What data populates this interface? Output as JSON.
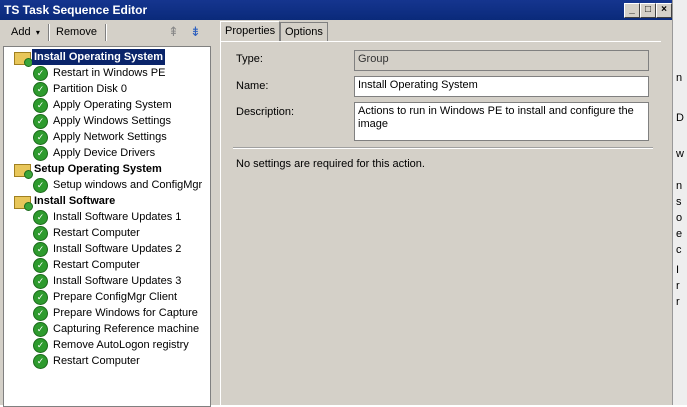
{
  "window": {
    "title": "TS Task Sequence Editor"
  },
  "toolbar": {
    "add_label": "Add",
    "remove_label": "Remove"
  },
  "tree": [
    {
      "label": "Install Operating System",
      "type": "group",
      "level": 0,
      "selected": true
    },
    {
      "label": "Restart in Windows PE",
      "type": "step",
      "level": 1
    },
    {
      "label": "Partition Disk 0",
      "type": "step",
      "level": 1
    },
    {
      "label": "Apply Operating System",
      "type": "step",
      "level": 1
    },
    {
      "label": "Apply Windows Settings",
      "type": "step",
      "level": 1
    },
    {
      "label": "Apply Network Settings",
      "type": "step",
      "level": 1
    },
    {
      "label": "Apply Device Drivers",
      "type": "step",
      "level": 1
    },
    {
      "label": "Setup Operating System",
      "type": "group",
      "level": 0
    },
    {
      "label": "Setup windows and ConfigMgr",
      "type": "step",
      "level": 1
    },
    {
      "label": "Install Software",
      "type": "group",
      "level": 0
    },
    {
      "label": "Install Software Updates 1",
      "type": "step",
      "level": 1
    },
    {
      "label": "Restart Computer",
      "type": "step",
      "level": 1
    },
    {
      "label": "Install Software Updates 2",
      "type": "step",
      "level": 1
    },
    {
      "label": "Restart Computer",
      "type": "step",
      "level": 1
    },
    {
      "label": "Install Software Updates 3",
      "type": "step",
      "level": 1
    },
    {
      "label": "Prepare ConfigMgr Client",
      "type": "step",
      "level": 1
    },
    {
      "label": "Prepare Windows for Capture",
      "type": "step",
      "level": 1
    },
    {
      "label": "Capturing Reference machine",
      "type": "step",
      "level": 1
    },
    {
      "label": "Remove AutoLogon registry",
      "type": "step",
      "level": 1
    },
    {
      "label": "Restart Computer",
      "type": "step",
      "level": 1
    }
  ],
  "tabs": [
    {
      "label": "Properties",
      "active": true
    },
    {
      "label": "Options",
      "active": false
    }
  ],
  "properties": {
    "type_label": "Type:",
    "type_value": "Group",
    "name_label": "Name:",
    "name_value": "Install Operating System",
    "description_label": "Description:",
    "description_value": "Actions to run in Windows PE to install and configure the image",
    "note": "No settings are required  for this action."
  },
  "background_fragments": [
    "n",
    "D",
    "w",
    "n",
    "s",
    "o",
    "e",
    "c",
    "I",
    "r",
    "r"
  ]
}
